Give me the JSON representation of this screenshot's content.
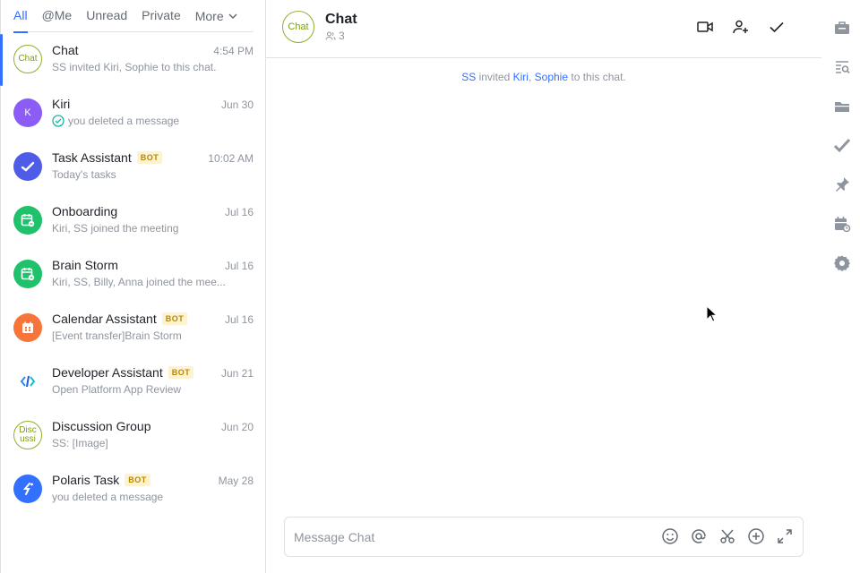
{
  "tabs": [
    {
      "label": "All",
      "active": true
    },
    {
      "label": "@Me",
      "active": false
    },
    {
      "label": "Unread",
      "active": false
    },
    {
      "label": "Private",
      "active": false
    },
    {
      "label": "More",
      "active": false
    }
  ],
  "chats": [
    {
      "name": "Chat",
      "time": "4:54 PM",
      "preview": "SS invited Kiri, Sophie to this chat.",
      "avatar_text": "Chat",
      "avatar": "outline",
      "bot": false,
      "selected": true
    },
    {
      "name": "Kiri",
      "time": "Jun 30",
      "preview": "you deleted a message",
      "avatar_text": "K",
      "avatar_color": "#8b5cf6",
      "bot": false,
      "read_icon": "check-circle-icon"
    },
    {
      "name": "Task Assistant",
      "time": "10:02 AM",
      "preview": "Today's tasks",
      "avatar_icon": "task-check-icon",
      "avatar_color": "#4f5ce8",
      "bot": true
    },
    {
      "name": "Onboarding",
      "time": "Jul 16",
      "preview": "Kiri, SS joined the meeting",
      "avatar_icon": "meeting-icon",
      "avatar_color": "#1fc16b",
      "bot": false
    },
    {
      "name": "Brain Storm",
      "time": "Jul 16",
      "preview": "Kiri, SS, Billy, Anna joined the mee...",
      "avatar_icon": "meeting-icon",
      "avatar_color": "#1fc16b",
      "bot": false
    },
    {
      "name": "Calendar Assistant",
      "time": "Jul 16",
      "preview": "[Event transfer]Brain Storm",
      "avatar_icon": "calendar-icon",
      "avatar_color": "#f7743b",
      "bot": true
    },
    {
      "name": "Developer Assistant",
      "time": "Jun 21",
      "preview": "Open Platform App Review",
      "avatar_icon": "code-icon",
      "avatar_color": "#ffffff",
      "bot": true
    },
    {
      "name": "Discussion Group",
      "time": "Jun 20",
      "preview": "SS: [Image]",
      "avatar_text": "Disc ussi",
      "avatar": "outline",
      "bot": false
    },
    {
      "name": "Polaris Task",
      "time": "May 28",
      "preview": "you deleted a message",
      "avatar_icon": "polaris-icon",
      "avatar_color": "#3370ff",
      "bot": true
    }
  ],
  "bot_label": "BOT",
  "header": {
    "avatar_text": "Chat",
    "title": "Chat",
    "members": "3"
  },
  "system_message": {
    "actor": "SS",
    "verb": "invited",
    "targets": [
      "Kiri",
      "Sophie"
    ],
    "sep": ",",
    "suffix": "to this chat."
  },
  "composer": {
    "placeholder": "Message Chat"
  },
  "colors": {
    "accent": "#3370ff",
    "muted": "#8f959e",
    "border": "#dee0e3"
  }
}
